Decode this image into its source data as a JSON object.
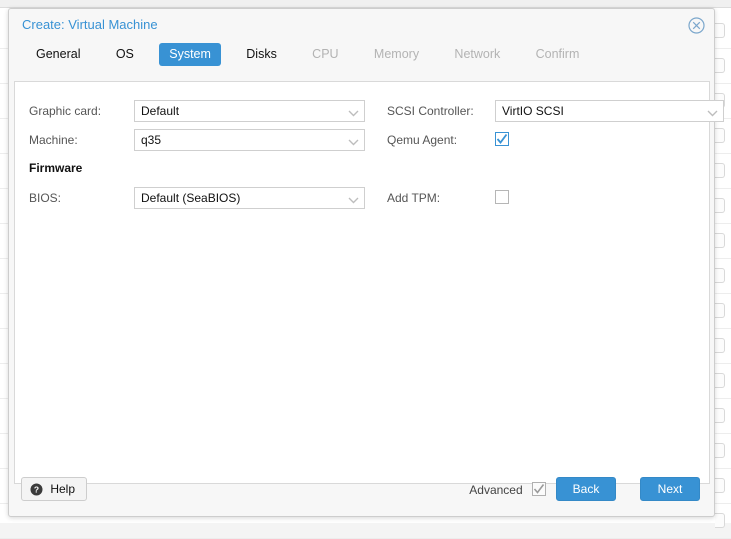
{
  "window": {
    "title": "Create: Virtual Machine",
    "close_icon": "close-circle-icon"
  },
  "tabs": [
    {
      "label": "General",
      "state": "enabled"
    },
    {
      "label": "OS",
      "state": "enabled"
    },
    {
      "label": "System",
      "state": "active"
    },
    {
      "label": "Disks",
      "state": "enabled"
    },
    {
      "label": "CPU",
      "state": "disabled"
    },
    {
      "label": "Memory",
      "state": "disabled"
    },
    {
      "label": "Network",
      "state": "disabled"
    },
    {
      "label": "Confirm",
      "state": "disabled"
    }
  ],
  "form": {
    "left": {
      "graphic_card_label": "Graphic card:",
      "graphic_card_value": "Default",
      "machine_label": "Machine:",
      "machine_value": "q35",
      "firmware_section": "Firmware",
      "bios_label": "BIOS:",
      "bios_value": "Default (SeaBIOS)"
    },
    "right": {
      "scsi_controller_label": "SCSI Controller:",
      "scsi_controller_value": "VirtIO SCSI",
      "qemu_agent_label": "Qemu Agent:",
      "qemu_agent_checked": true,
      "add_tpm_label": "Add TPM:",
      "add_tpm_checked": false
    }
  },
  "footer": {
    "help_label": "Help",
    "help_icon": "question-circle-icon",
    "advanced_label": "Advanced",
    "advanced_checked": true,
    "back_label": "Back",
    "next_label": "Next"
  },
  "colors": {
    "accent": "#3892d4",
    "title": "#3892d4",
    "label": "#555555",
    "disabled_tab": "#b3b3b3",
    "panel_bg": "#ffffff",
    "window_bg": "#f7f7f7"
  }
}
